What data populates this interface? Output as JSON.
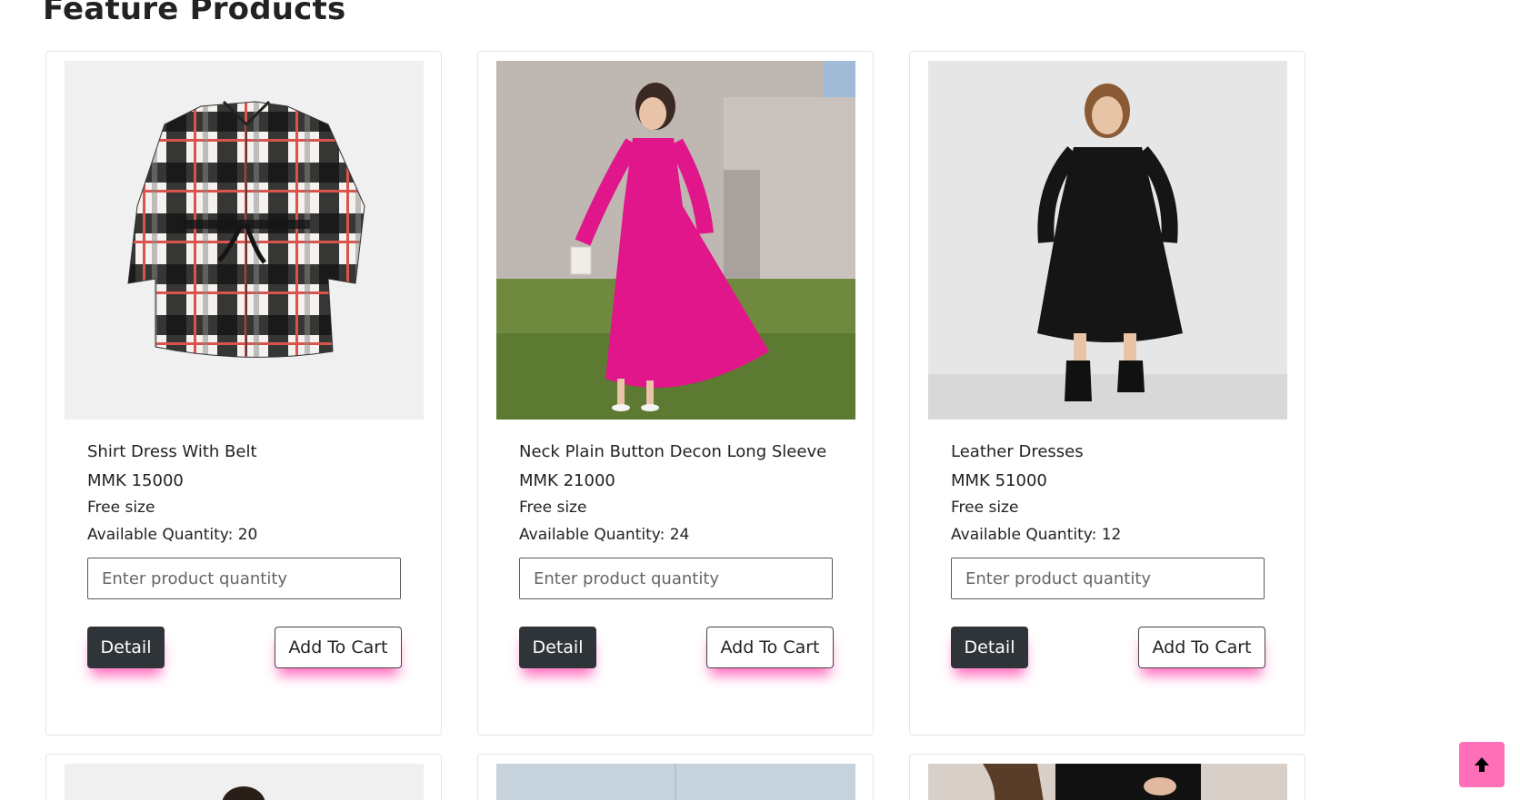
{
  "section": {
    "title": "Feature Products"
  },
  "products": [
    {
      "name": "Shirt Dress With Belt",
      "price": "MMK 15000",
      "size": "Free size",
      "available": "Available Quantity: 20",
      "qty_placeholder": "Enter product quantity",
      "detail_label": "Detail",
      "cart_label": "Add To Cart"
    },
    {
      "name": "Neck Plain Button Decon Long Sleeve",
      "price": "MMK 21000",
      "size": "Free size",
      "available": "Available Quantity: 24",
      "qty_placeholder": "Enter product quantity",
      "detail_label": "Detail",
      "cart_label": "Add To Cart"
    },
    {
      "name": "Leather Dresses",
      "price": "MMK 51000",
      "size": "Free size",
      "available": "Available Quantity: 12",
      "qty_placeholder": "Enter product quantity",
      "detail_label": "Detail",
      "cart_label": "Add To Cart"
    }
  ],
  "colors": {
    "accent_pink": "#ff6fb8",
    "dark_button": "#2f3439",
    "dress_pink": "#e0168a",
    "dress_black": "#151515"
  },
  "icons": {
    "scroll_top": "arrow-up-icon"
  }
}
